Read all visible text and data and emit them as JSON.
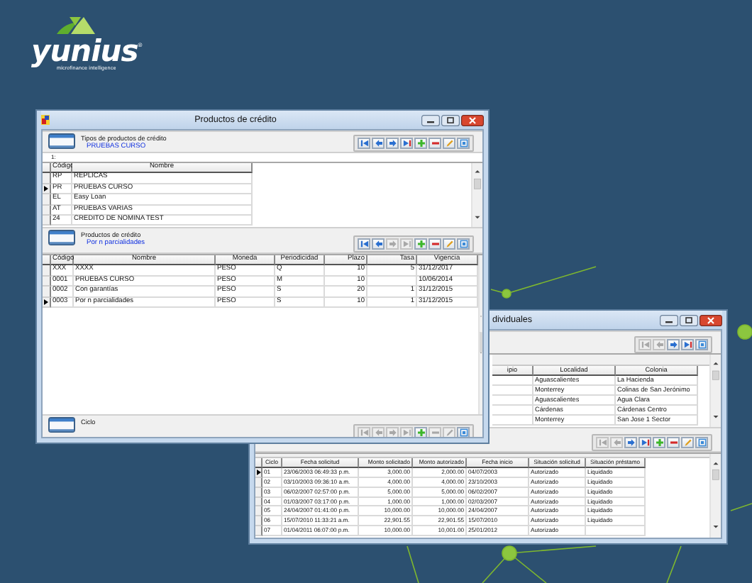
{
  "logo": {
    "name": "yunius",
    "mark": "®",
    "tagline": "microfinance intelligence"
  },
  "front_window": {
    "title": "Productos de crédito",
    "types_panel": {
      "heading": "Tipos de productos de crédito",
      "subtitle": "PRUEBAS CURSO",
      "toolbar": [
        {
          "kind": "first",
          "disabled": false
        },
        {
          "kind": "previous",
          "disabled": false
        },
        {
          "kind": "next",
          "disabled": false
        },
        {
          "kind": "last",
          "disabled": false
        },
        {
          "kind": "add",
          "disabled": false
        },
        {
          "kind": "remove",
          "disabled": false
        },
        {
          "kind": "edit",
          "disabled": false
        },
        {
          "kind": "refresh",
          "disabled": false
        }
      ]
    },
    "filter": "1:",
    "types_table": {
      "columns": [
        {
          "label": "Código",
          "numeric": false
        },
        {
          "label": "Nombre",
          "numeric": false
        }
      ],
      "rows": [
        {
          "cells": [
            "RP",
            "REPLICAS"
          ],
          "selected": false
        },
        {
          "cells": [
            "PR",
            "PRUEBAS CURSO"
          ],
          "selected": true
        },
        {
          "cells": [
            "EL",
            "Easy Loan"
          ],
          "selected": false
        },
        {
          "cells": [
            "AT",
            "PRUEBAS VARIAS"
          ],
          "selected": false
        },
        {
          "cells": [
            "24",
            "CREDITO DE NOMINA TEST"
          ],
          "selected": false
        }
      ]
    },
    "products_panel": {
      "heading": "Productos de crédito",
      "subtitle": "Por n parcialidades",
      "toolbar": [
        {
          "kind": "first",
          "disabled": false
        },
        {
          "kind": "previous",
          "disabled": false
        },
        {
          "kind": "next",
          "disabled": true
        },
        {
          "kind": "last",
          "disabled": true
        },
        {
          "kind": "add",
          "disabled": false
        },
        {
          "kind": "remove",
          "disabled": false
        },
        {
          "kind": "edit",
          "disabled": false
        },
        {
          "kind": "refresh",
          "disabled": false
        }
      ]
    },
    "products_table": {
      "columns": [
        {
          "label": "Código",
          "numeric": false
        },
        {
          "label": "Nombre",
          "numeric": false
        },
        {
          "label": "Moneda",
          "numeric": false
        },
        {
          "label": "Periodicidad",
          "numeric": false
        },
        {
          "label": "Plazo",
          "numeric": true
        },
        {
          "label": "Tasa",
          "numeric": true
        },
        {
          "label": "Vigencia",
          "numeric": false
        }
      ],
      "rows": [
        {
          "cells": [
            "XXX",
            "XXXX",
            "PESO",
            "Q",
            "10",
            "5",
            "31/12/2017"
          ],
          "selected": false
        },
        {
          "cells": [
            "0001",
            "PRUEBAS CURSO",
            "PESO",
            "M",
            "10",
            null,
            "10/06/2014"
          ],
          "selected": false
        },
        {
          "cells": [
            "0002",
            "Con garantías",
            "PESO",
            "S",
            "20",
            "1",
            "31/12/2015"
          ],
          "selected": false
        },
        {
          "cells": [
            "0003",
            "Por n parcialidades",
            "PESO",
            "S",
            "10",
            "1",
            "31/12/2015"
          ],
          "selected": true
        }
      ]
    },
    "cycle_panel": {
      "heading": "Ciclo",
      "toolbar": [
        {
          "kind": "first",
          "disabled": true
        },
        {
          "kind": "previous",
          "disabled": true
        },
        {
          "kind": "next",
          "disabled": true
        },
        {
          "kind": "last",
          "disabled": true
        },
        {
          "kind": "add",
          "disabled": false
        },
        {
          "kind": "remove",
          "disabled": true
        },
        {
          "kind": "edit",
          "disabled": true
        },
        {
          "kind": "refresh",
          "disabled": false
        }
      ]
    }
  },
  "back_window": {
    "title": "dividuales",
    "toolbar": [
      {
        "kind": "first",
        "disabled": true
      },
      {
        "kind": "previous",
        "disabled": true
      },
      {
        "kind": "next",
        "disabled": false
      },
      {
        "kind": "last",
        "disabled": false
      },
      {
        "kind": "refresh",
        "disabled": false
      }
    ],
    "addresses_table": {
      "columns": [
        {
          "label": "ipio",
          "numeric": false
        },
        {
          "label": "Localidad",
          "numeric": false
        },
        {
          "label": "Colonia",
          "numeric": false
        }
      ],
      "rows": [
        {
          "cells": [
            null,
            "Aguascalientes",
            "La Hacienda"
          ]
        },
        {
          "cells": [
            null,
            "Monterrey",
            "Colinas de San Jerónimo"
          ]
        },
        {
          "cells": [
            null,
            "Aguascalientes",
            "Agua Clara"
          ]
        },
        {
          "cells": [
            null,
            "Cárdenas",
            "Cárdenas Centro"
          ]
        },
        {
          "cells": [
            null,
            "Monterrey",
            "San Jose 1 Sector"
          ]
        }
      ]
    },
    "cycles_toolbar": [
      {
        "kind": "first",
        "disabled": true
      },
      {
        "kind": "previous",
        "disabled": true
      },
      {
        "kind": "next",
        "disabled": false
      },
      {
        "kind": "last",
        "disabled": false
      },
      {
        "kind": "add",
        "disabled": false
      },
      {
        "kind": "remove",
        "disabled": false
      },
      {
        "kind": "edit",
        "disabled": false
      },
      {
        "kind": "refresh",
        "disabled": false
      }
    ],
    "cycles_table": {
      "columns": [
        {
          "label": "Ciclo",
          "numeric": false
        },
        {
          "label": "Fecha solicitud",
          "numeric": false
        },
        {
          "label": "Monto solicitado",
          "numeric": true
        },
        {
          "label": "Monto autorizado",
          "numeric": true
        },
        {
          "label": "Fecha inicio",
          "numeric": false
        },
        {
          "label": "Situación solicitud",
          "numeric": false
        },
        {
          "label": "Situación préstamo",
          "numeric": false
        }
      ],
      "rows": [
        {
          "cells": [
            "01",
            "23/06/2003 06:49:33 p.m.",
            "3,000.00",
            "2,000.00",
            "04/07/2003",
            "Autorizado",
            "Liquidado"
          ],
          "selected": true
        },
        {
          "cells": [
            "02",
            "03/10/2003 09:36:10 a.m.",
            "4,000.00",
            "4,000.00",
            "23/10/2003",
            "Autorizado",
            "Liquidado"
          ],
          "selected": false
        },
        {
          "cells": [
            "03",
            "06/02/2007 02:57:00 p.m.",
            "5,000.00",
            "5,000.00",
            "06/02/2007",
            "Autorizado",
            "Liquidado"
          ],
          "selected": false
        },
        {
          "cells": [
            "04",
            "01/03/2007 03:17:00 p.m.",
            "1,000.00",
            "1,000.00",
            "02/03/2007",
            "Autorizado",
            "Liquidado"
          ],
          "selected": false
        },
        {
          "cells": [
            "05",
            "24/04/2007 01:41:00 p.m.",
            "10,000.00",
            "10,000.00",
            "24/04/2007",
            "Autorizado",
            "Liquidado"
          ],
          "selected": false
        },
        {
          "cells": [
            "06",
            "15/07/2010 11:33:21 a.m.",
            "22,901.55",
            "22,901.55",
            "15/07/2010",
            "Autorizado",
            "Liquidado"
          ],
          "selected": false
        },
        {
          "cells": [
            "07",
            "01/04/2011 06:07:00 p.m.",
            "10,000.00",
            "10,001.00",
            "25/01/2012",
            "Autorizado",
            null
          ],
          "selected": false
        }
      ]
    }
  }
}
